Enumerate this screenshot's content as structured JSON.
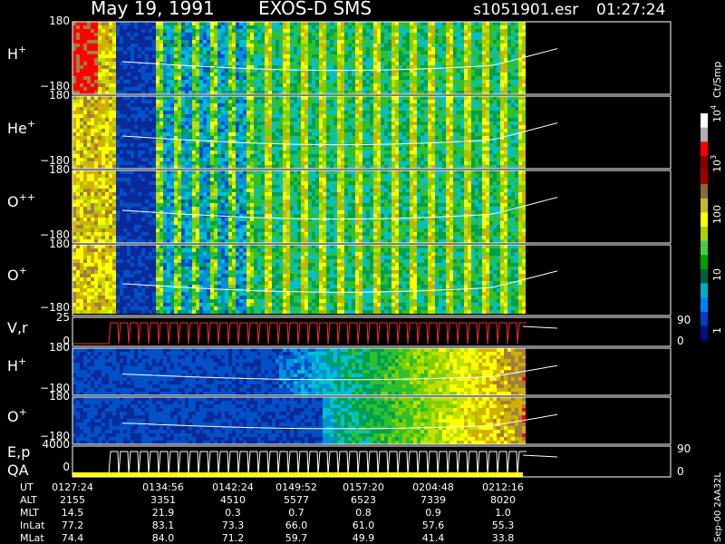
{
  "header": {
    "date": "May 19, 1991",
    "instrument": "EXOS-D SMS",
    "file": "s1051901.esr",
    "time": "01:27:24"
  },
  "colors": {
    "background": "#000000",
    "trace": "#ffffff",
    "velocity_trace": "#ff2a2a"
  },
  "colorbar": {
    "unit": "Ct/Smp",
    "ticks": [
      "1",
      "10",
      "100",
      "10",
      "10"
    ],
    "tick_exps": [
      "",
      "",
      "",
      "3",
      "4"
    ],
    "scale": [
      "#ffffff",
      "#b0b0b0",
      "#ff0000",
      "#8a0000",
      "#a00000",
      "#8a6a3a",
      "#c8b830",
      "#ffff00",
      "#b0d000",
      "#40d040",
      "#00a000",
      "#006040",
      "#00b0c0",
      "#0080ff",
      "#0040c0",
      "#001080"
    ]
  },
  "chart_data": [
    {
      "type": "heatmap",
      "panel": "H+ energy-angle",
      "label": "H",
      "label_sup": "+",
      "ylim": [
        -180,
        180
      ],
      "ytick_labels": [
        "180",
        "−180"
      ]
    },
    {
      "type": "heatmap",
      "panel": "He+ energy-angle",
      "label": "He",
      "label_sup": "+",
      "ylim": [
        -180,
        180
      ],
      "ytick_labels": [
        "180",
        "−180"
      ]
    },
    {
      "type": "heatmap",
      "panel": "O++ energy-angle",
      "label": "O",
      "label_sup": "++",
      "ylim": [
        -180,
        180
      ],
      "ytick_labels": [
        "180",
        "−180"
      ]
    },
    {
      "type": "heatmap",
      "panel": "O+ energy-angle",
      "label": "O",
      "label_sup": "+",
      "ylim": [
        -180,
        180
      ],
      "ytick_labels": [
        "180",
        "−180"
      ]
    },
    {
      "type": "line",
      "panel": "V,r",
      "label": "V,r",
      "ylim": [
        0,
        25
      ],
      "ytick_labels": [
        "25",
        "0"
      ],
      "right_tick_labels": [
        "90",
        "0"
      ]
    },
    {
      "type": "heatmap",
      "panel": "H+ energy-time",
      "label": "H",
      "label_sup": "+",
      "ylim": [
        -180,
        180
      ],
      "ytick_labels": [
        "180",
        "−180"
      ]
    },
    {
      "type": "heatmap",
      "panel": "O+ energy-time",
      "label": "O",
      "label_sup": "+",
      "ylim": [
        -180,
        180
      ],
      "ytick_labels": [
        "180",
        "−180"
      ]
    },
    {
      "type": "line",
      "panel": "E,p QA",
      "label": "E,p",
      "label2": "QA",
      "ylim": [
        0,
        4000
      ],
      "ytick_labels": [
        "4000",
        "0"
      ],
      "right_tick_labels": [
        "90",
        "0"
      ]
    }
  ],
  "x_axis": {
    "rows": [
      {
        "name": "UT",
        "values": [
          "0127:24",
          "0134:56",
          "0142:24",
          "0149:52",
          "0157:20",
          "0204:48",
          "0212:16"
        ]
      },
      {
        "name": "ALT",
        "values": [
          "2155",
          "3351",
          "4510",
          "5577",
          "6523",
          "7339",
          "8020"
        ]
      },
      {
        "name": "MLT",
        "values": [
          "14.5",
          "21.9",
          "0.3",
          "0.7",
          "0.8",
          "0.9",
          "1.0"
        ]
      },
      {
        "name": "InLat",
        "values": [
          "77.2",
          "83.1",
          "73.3",
          "66.0",
          "61.0",
          "57.6",
          "55.3"
        ]
      },
      {
        "name": "MLat",
        "values": [
          "74.4",
          "84.0",
          "71.2",
          "59.7",
          "49.9",
          "41.4",
          "33.8"
        ]
      }
    ]
  },
  "footer": {
    "version": "Sep-00  2AA32L"
  }
}
